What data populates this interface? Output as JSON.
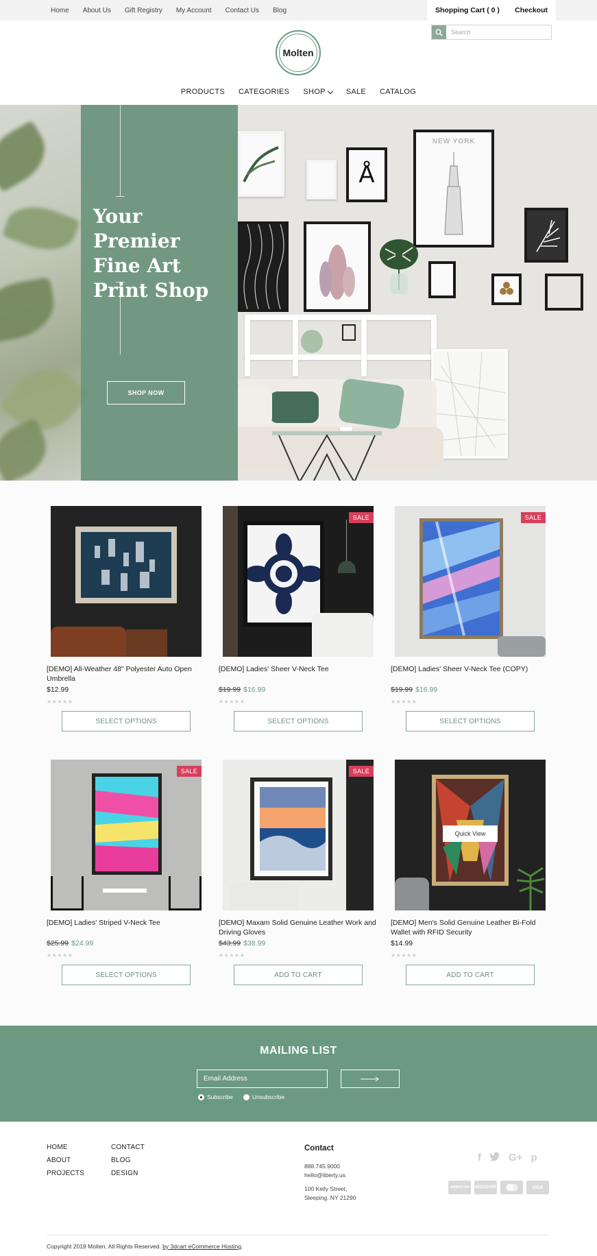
{
  "topbar": {
    "links": [
      "Home",
      "About Us",
      "Gift Registry",
      "My Account",
      "Contact Us",
      "Blog"
    ],
    "cart_label": "Shopping Cart ( 0 )",
    "checkout_label": "Checkout"
  },
  "search": {
    "placeholder": "Search"
  },
  "logo": {
    "text": "Molten"
  },
  "nav": {
    "products": "PRODUCTS",
    "categories": "CATEGORIES",
    "shop": "SHOP",
    "sale": "SALE",
    "catalog": "CATALOG"
  },
  "hero": {
    "heading": "Your Premier Fine Art Print Shop",
    "button": "SHOP NOW",
    "poster_text": "NEW YORK",
    "poster_letter": "Å"
  },
  "products": [
    {
      "name": "[DEMO] All-Weather 48\" Polyester Auto Open Umbrella",
      "price": "$12.99",
      "old_price": "",
      "sale": false,
      "button": "SELECT OPTIONS",
      "rating": 0
    },
    {
      "name": "[DEMO] Ladies' Sheer V-Neck Tee",
      "price": "$16.99",
      "old_price": "$19.99",
      "sale": true,
      "button": "SELECT OPTIONS",
      "rating": 0
    },
    {
      "name": "[DEMO] Ladies' Sheer V-Neck Tee (COPY)",
      "price": "$16.99",
      "old_price": "$19.99",
      "sale": true,
      "button": "SELECT OPTIONS",
      "rating": 0
    },
    {
      "name": "[DEMO] Ladies' Striped V-Neck Tee",
      "price": "$24.99",
      "old_price": "$25.99",
      "sale": true,
      "button": "SELECT OPTIONS",
      "rating": 0
    },
    {
      "name": "[DEMO] Maxam Solid Genuine Leather Work and Driving Gloves",
      "price": "$38.99",
      "old_price": "$43.99",
      "sale": true,
      "button": "ADD TO CART",
      "rating": 0
    },
    {
      "name": "[DEMO] Men's Solid Genuine Leather Bi-Fold Wallet with RFID Security",
      "price": "$14.99",
      "old_price": "",
      "sale": false,
      "button": "ADD TO CART",
      "rating": 0,
      "quick_view": "Quick View"
    }
  ],
  "sale_badge": "SALE",
  "stars": "★★★★★",
  "mailing": {
    "title": "MAILING LIST",
    "email_placeholder": "Email Address",
    "subscribe": "Subscribe",
    "unsubscribe": "Unsubscribe",
    "selected": "subscribe"
  },
  "footer": {
    "col1": [
      "HOME",
      "ABOUT",
      "PROJECTS"
    ],
    "col2": [
      "CONTACT",
      "BLOG",
      "DESIGN"
    ],
    "contact_title": "Contact",
    "phone": "888.745.9000",
    "email": "hello@liberty.us",
    "address1": "100 Kelly Street,",
    "address2": "Sleeping, NY 21290",
    "social": [
      "f",
      "t",
      "G+",
      "p"
    ],
    "payments": [
      "AMERICAN",
      "DISCOVER",
      "MC",
      "VISA"
    ],
    "copyright": "Copyright 2019 Molten. All Rights Reserved.",
    "copyright_link": "by 3dcart eCommerce Hosting",
    "copyright_end": "."
  },
  "colors": {
    "accent": "#6b9a80",
    "sale": "#d83f5b",
    "topbar": "#f2f2f2"
  }
}
